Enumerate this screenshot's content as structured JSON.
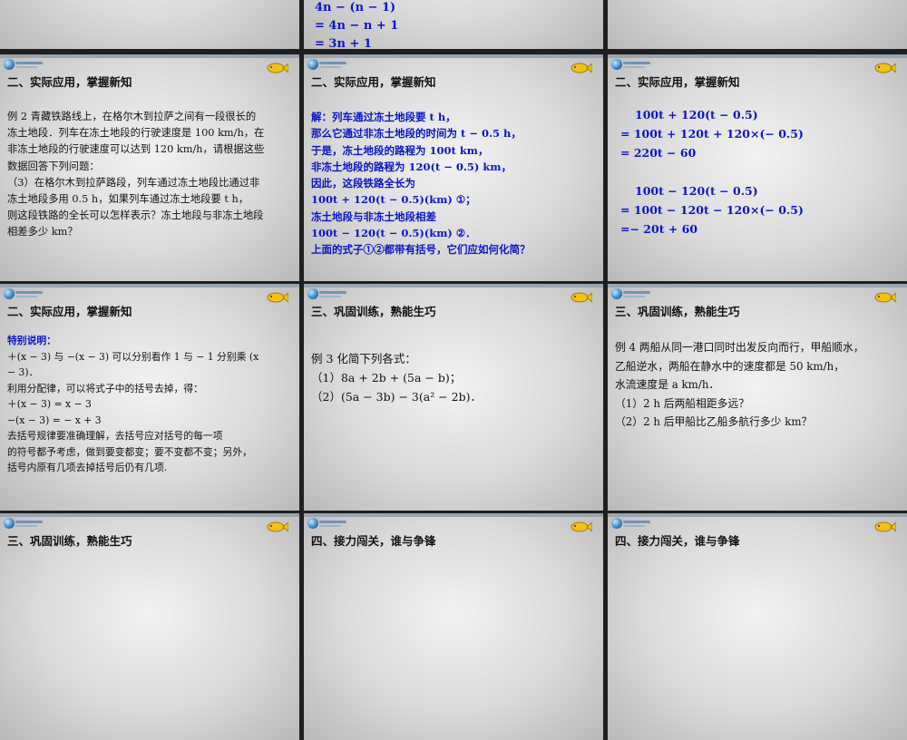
{
  "slides": {
    "s1": {
      "lines": [
        "4n − (n − 1)",
        "= 4n − n + 1",
        "= 3n + 1"
      ]
    },
    "s4": {
      "heading": "二、实际应用，掌握新知",
      "lines": [
        "例 2  青藏铁路线上，在格尔木到拉萨之间有一段很长的",
        "冻土地段．列车在冻土地段的行驶速度是 100 km/h，在",
        "非冻土地段的行驶速度可以达到 120 km/h，请根据这些",
        "数据回答下列问题：",
        "（3）在格尔木到拉萨路段，列车通过冻土地段比通过非",
        "冻土地段多用 0.5 h，如果列车通过冻土地段要 t h，",
        "则这段铁路的全长可以怎样表示？冻土地段与非冻土地段",
        "相差多少 km？"
      ]
    },
    "s5": {
      "heading": "二、实际应用，掌握新知",
      "lines": [
        "解：列车通过冻土地段要 t h，",
        "那么它通过非冻土地段的时间为 t − 0.5  h，",
        "于是，冻土地段的路程为 100t km，",
        "非冻土地段的路程为 120(t − 0.5) km，",
        "因此，这段铁路全长为",
        "  100t + 120(t − 0.5)(km)   ①；",
        "冻土地段与非冻土地段相差",
        "  100t − 120(t − 0.5)(km)   ②．",
        "上面的式子①②都带有括号，它们应如何化简？"
      ]
    },
    "s6": {
      "heading": "二、实际应用，掌握新知",
      "lines": [
        "100t + 120(t − 0.5)",
        "= 100t + 120t + 120×(− 0.5)",
        "= 220t − 60",
        "",
        "100t − 120(t − 0.5)",
        "= 100t − 120t − 120×(− 0.5)",
        "=− 20t + 60"
      ]
    },
    "s7": {
      "heading": "二、实际应用，掌握新知",
      "note_title": "特别说明：",
      "lines": [
        "＋(x − 3) 与 −(x − 3) 可以分别看作 1 与 − 1 分别乘 (x",
        "   − 3)．",
        "利用分配律，可以将式子中的括号去掉，得：",
        "＋(x − 3) = x − 3",
        "−(x − 3) = − x + 3",
        "        去括号规律要准确理解，去括号应对括号的每一项",
        "的符号都予考虑，做到要变都变；要不变都不变；另外，",
        "括号内原有几项去掉括号后仍有几项."
      ]
    },
    "s8": {
      "heading": "三、巩固训练，熟能生巧",
      "lines": [
        "例 3  化简下列各式：",
        "（1）8a + 2b + (5a − b)；",
        "（2）(5a − 3b) − 3(a² − 2b)．"
      ]
    },
    "s9": {
      "heading": "三、巩固训练，熟能生巧",
      "lines": [
        "例 4  两船从同一港口同时出发反向而行，甲船顺水，",
        "乙船逆水，两船在静水中的速度都是 50 km/h，",
        "水流速度是 a km/h．",
        "（1）2 h 后两船相距多远？",
        "（2）2 h 后甲船比乙船多航行多少 km？"
      ]
    },
    "s10": {
      "heading": "三、巩固训练，熟能生巧"
    },
    "s11": {
      "heading": "四、接力闯关，谁与争锋"
    },
    "s12": {
      "heading": "四、接力闯关，谁与争锋"
    }
  },
  "colors": {
    "blue_text": "#0a14c8",
    "red_text": "#d3121f",
    "gap": "#1f1f1f"
  },
  "icons": [
    "globe-logo-icon",
    "fish-icon"
  ]
}
